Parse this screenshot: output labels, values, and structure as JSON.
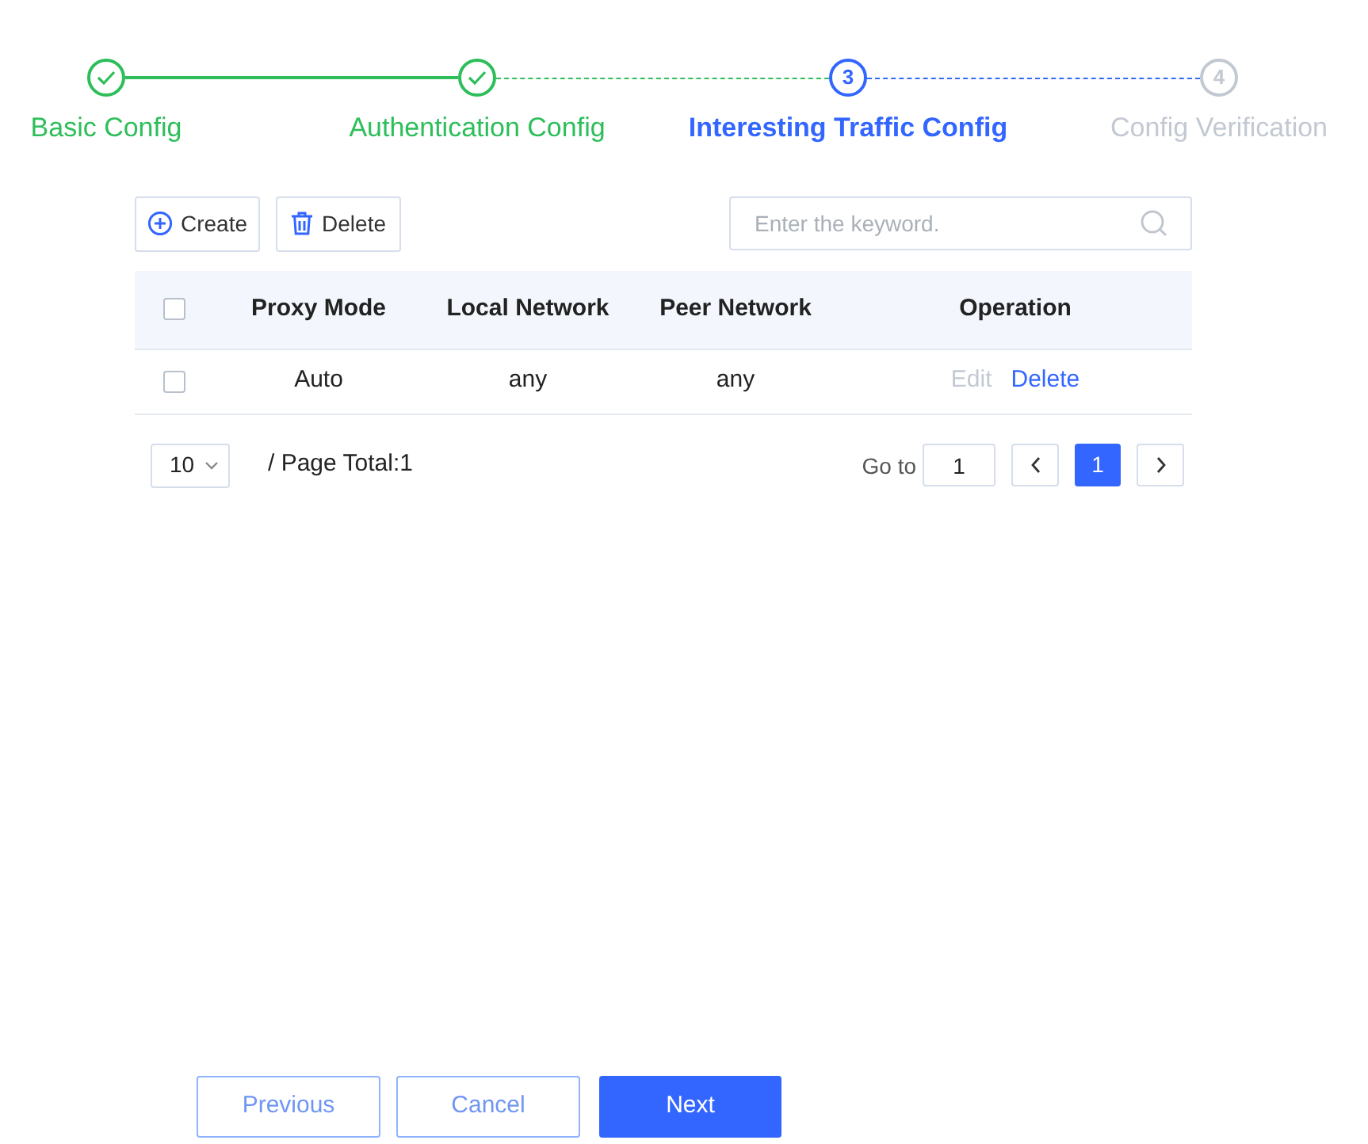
{
  "steps": [
    {
      "label": "Basic Config",
      "completed": true
    },
    {
      "label": "Authentication Config",
      "completed": true
    },
    {
      "label": "Interesting Traffic Config",
      "number": "3",
      "completed": false,
      "current": true
    },
    {
      "label": "Config Verification",
      "number": "4",
      "completed": false,
      "current": false
    }
  ],
  "toolbar": {
    "create": "Create",
    "delete": "Delete",
    "search": {
      "placeholder": "Enter the keyword."
    }
  },
  "table": {
    "columns": [
      "Proxy Mode",
      "Local Network",
      "Peer Network",
      "Operation"
    ],
    "all_checked": false,
    "rows": [
      {
        "checked": false,
        "cells": [
          "Auto",
          "any",
          "any"
        ],
        "actions": [
          {
            "label": "Edit",
            "disabled": true
          },
          {
            "label": "Delete",
            "disabled": false
          }
        ]
      }
    ]
  },
  "pagination": {
    "page_size": "10",
    "total": "/ Page Total:1",
    "goto_label": "Go to",
    "goto_value": "1",
    "pages": [
      {
        "label": "1",
        "selected": true
      }
    ]
  },
  "footer": [
    {
      "label": "Previous",
      "kind": "outline"
    },
    {
      "label": "Cancel",
      "kind": "outline"
    },
    {
      "label": "Next",
      "kind": "primary"
    }
  ]
}
